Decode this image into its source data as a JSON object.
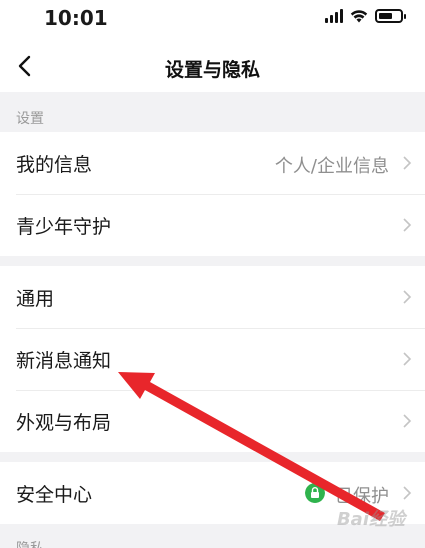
{
  "status_bar": {
    "time": "10:01"
  },
  "nav": {
    "title": "设置与隐私"
  },
  "sections": {
    "settings_header": "设置",
    "privacy_header": "隐私"
  },
  "group1": {
    "my_info": {
      "label": "我的信息",
      "value": "个人/企业信息"
    },
    "youth_mode": {
      "label": "青少年守护"
    }
  },
  "group2": {
    "general": {
      "label": "通用"
    },
    "notifications": {
      "label": "新消息通知"
    },
    "appearance": {
      "label": "外观与布局"
    }
  },
  "group3": {
    "security": {
      "label": "安全中心",
      "value": "已保护"
    }
  },
  "watermark": "Bai\u0001经验",
  "colors": {
    "accent_red": "#e8262b",
    "shield_green": "#2fb34d"
  }
}
